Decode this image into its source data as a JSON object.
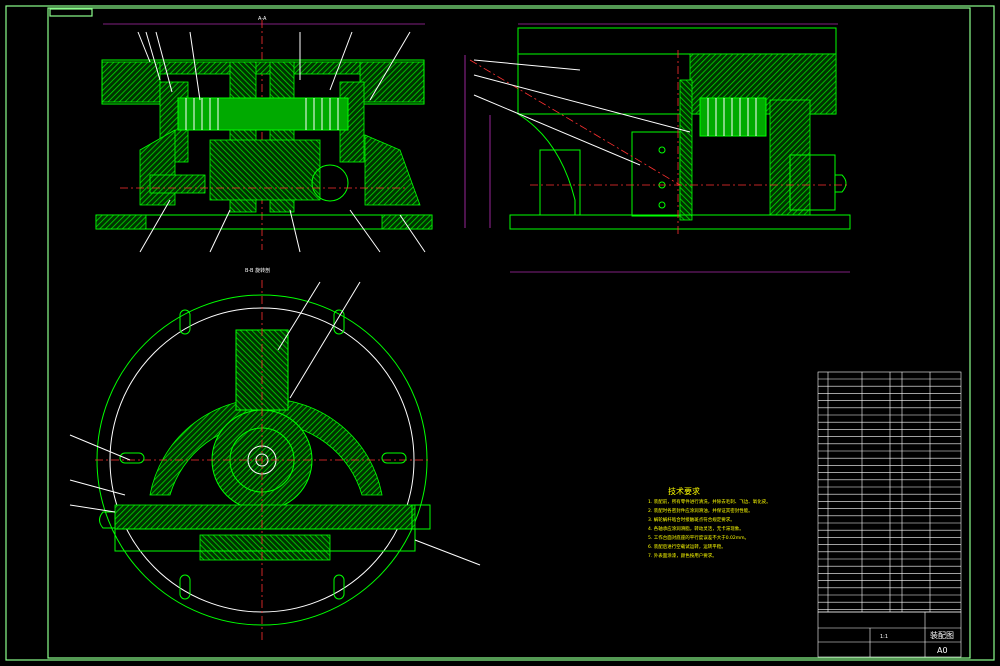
{
  "section_labels": {
    "top_section": "A-A",
    "bottom_section": "B-B",
    "bottom_section_caption": "B-B 旋转剖"
  },
  "technical_notes": {
    "title": "技术要求",
    "lines": [
      "1. 装配前，所有零件进行清洗，并除去毛刺、飞边、氧化皮。",
      "2. 装配时各密封件应涂润滑油，并保证其密封性能。",
      "3. 蜗轮蜗杆啮合时接触斑点符合规定要求。",
      "4. 各轴承应涂润滑脂，转动灵活，无卡滞现象。",
      "5. 工作台面对底座的平行度误差不大于0.02mm。",
      "6. 装配后进行空载试运转，运转平稳。",
      "7. 外表面涂漆，颜色按用户要求。"
    ]
  },
  "title_block": {
    "drawing_name": "装配图",
    "scale": "1:1",
    "sheet_code": "A0"
  },
  "colors": {
    "frame": "#8cff8c",
    "outline": "#00ff00",
    "hatch": "#00cc00",
    "center_line": "#ff3030",
    "dimension": "#ff40ff",
    "annotation": "#ffff00",
    "table_text": "#ffffff"
  }
}
